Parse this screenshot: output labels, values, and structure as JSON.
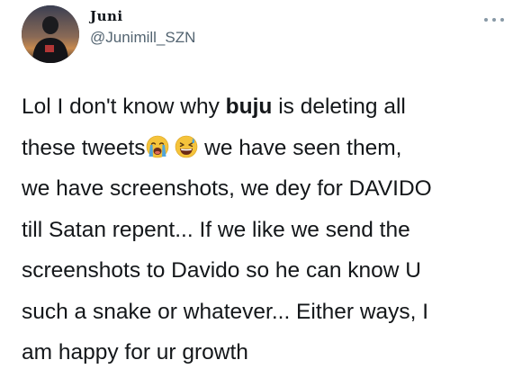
{
  "author": {
    "display_name": "Juni",
    "handle": "@Junimill_SZN",
    "avatar_icon": "profile-avatar"
  },
  "more_icon": "more-horizontal-icon",
  "tweet": {
    "line1_pre": "Lol I don't know why ",
    "line1_bold": "buju",
    "line1_post": " is deleting all",
    "line2_pre": "these tweets",
    "line2_post": " we have seen them,",
    "line3": "we have screenshots, we dey for DAVIDO",
    "line4": "till Satan repent... If we like we send the",
    "line5": "screenshots to Davido so he can know U",
    "line6": "such a snake or whatever... Either ways, I",
    "line7": "am happy for ur growth",
    "emoji_1": "loudly-crying-face",
    "emoji_2": "grinning-squinting-sweat-face"
  },
  "colors": {
    "text": "#14171a",
    "secondary": "#536471",
    "emoji_yellow": "#f5c33b",
    "emoji_tears": "#4aa3e0"
  }
}
